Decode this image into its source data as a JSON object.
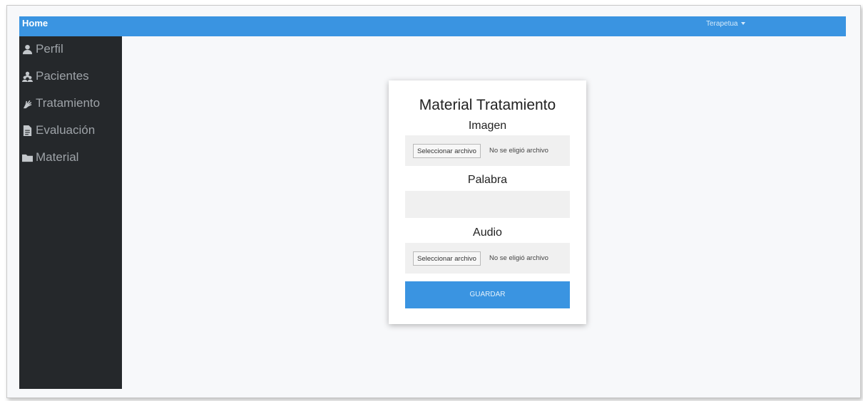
{
  "navbar": {
    "home_label": "Home",
    "user_menu_label": "Terapetua",
    "accent_color": "#3a94e1"
  },
  "sidebar": {
    "items": [
      {
        "label": "Perfil",
        "icon": "user-icon"
      },
      {
        "label": "Pacientes",
        "icon": "users-icon"
      },
      {
        "label": "Tratamiento",
        "icon": "sign-language-icon"
      },
      {
        "label": "Evaluación",
        "icon": "document-icon"
      },
      {
        "label": "Material",
        "icon": "folder-icon"
      }
    ],
    "background_color": "#25282b"
  },
  "form": {
    "title": "Material Tratamiento",
    "image_label": "Imagen",
    "image_file": {
      "button_label": "Seleccionar archivo",
      "status": "No se eligió archivo"
    },
    "word_label": "Palabra",
    "word_value": "",
    "audio_label": "Audio",
    "audio_file": {
      "button_label": "Seleccionar archivo",
      "status": "No se eligió archivo"
    },
    "save_label": "GUARDAR"
  }
}
